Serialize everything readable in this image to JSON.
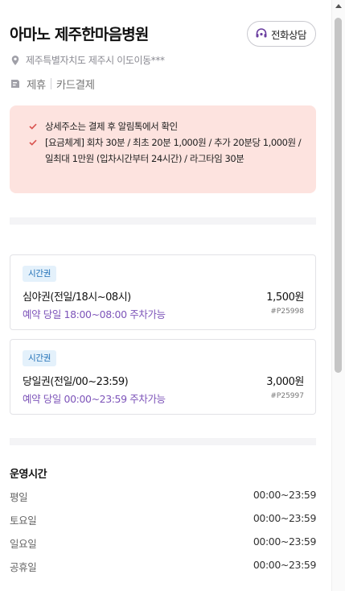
{
  "header": {
    "title": "아마노 제주한마음병원",
    "call_label": "전화상담"
  },
  "location": {
    "address": "제주특별자치도 제주시 이도이동***"
  },
  "tags": {
    "partner": "제휴",
    "payment": "카드결제"
  },
  "notice": {
    "items": [
      "상세주소는 결제 후 알림톡에서 확인",
      "[요금체계] 회차 30분 / 최초 20분 1,000원 / 추가 20분당 1,000원 / 일최대 1만원 (입차시간부터 24시간) / 라그타임 30분"
    ]
  },
  "tickets": [
    {
      "badge": "시간권",
      "name": "심야권(전일/18시~08시)",
      "price": "1,500원",
      "availability": "예약 당일 18:00~08:00 주차가능",
      "code": "#P25998"
    },
    {
      "badge": "시간권",
      "name": "당일권(전일/00~23:59)",
      "price": "3,000원",
      "availability": "예약 당일 00:00~23:59 주차가능",
      "code": "#P25997"
    }
  ],
  "hours": {
    "title": "운영시간",
    "rows": [
      {
        "day": "평일",
        "time": "00:00~23:59"
      },
      {
        "day": "토요일",
        "time": "00:00~23:59"
      },
      {
        "day": "일요일",
        "time": "00:00~23:59"
      },
      {
        "day": "공휴일",
        "time": "00:00~23:59"
      }
    ]
  },
  "colors": {
    "notice_bg": "#fde3df",
    "check": "#d9534f",
    "badge_bg": "#e4f1fb",
    "badge_text": "#1f6fb6",
    "availability_text": "#7d54b9",
    "call_icon": "#6b3fa0"
  },
  "icons": {
    "call": "headset-icon",
    "location": "map-pin-icon",
    "tag": "tag-icon",
    "check": "check-icon"
  }
}
